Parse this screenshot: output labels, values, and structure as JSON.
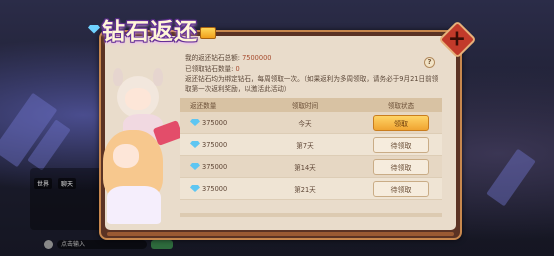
{
  "window": {
    "title": "钻石返还"
  },
  "info": {
    "total_label": "我的返还钻石总额:",
    "total_value": "7500000",
    "claimed_label": "已领取钻石数量:",
    "claimed_value": "0",
    "description": "返还钻石均为绑定钻石，每周领取一次。（如果返利为多周领取，请务必于9月21日前领取第一次返利奖励，以激活此活动）"
  },
  "table": {
    "headers": [
      "返还数量",
      "领取时间",
      "领取状态"
    ],
    "rows": [
      {
        "amount": "375000",
        "time": "今天",
        "status": "领取",
        "claimable": true
      },
      {
        "amount": "375000",
        "time": "第7天",
        "status": "待领取",
        "claimable": false
      },
      {
        "amount": "375000",
        "time": "第14天",
        "status": "待领取",
        "claimable": false
      },
      {
        "amount": "375000",
        "time": "第21天",
        "status": "待领取",
        "claimable": false
      }
    ]
  },
  "chat": {
    "tag1": "世界",
    "tag2": "聊天",
    "input_placeholder": "点击输入"
  },
  "icons": {
    "close": "close-icon",
    "help": "help-icon",
    "gem": "diamond-icon",
    "chest": "treasure-chest-icon"
  },
  "colors": {
    "accent": "#f0a431",
    "value_text": "#a64a2d",
    "close_red": "#c23a2a"
  }
}
